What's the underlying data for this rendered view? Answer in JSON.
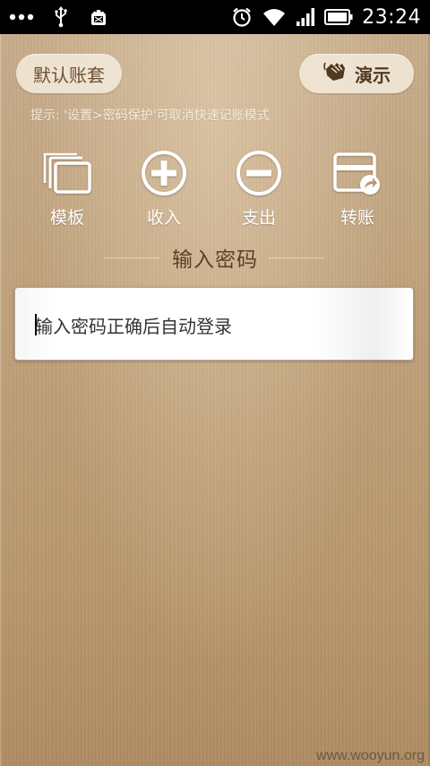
{
  "status_bar": {
    "time": "23:24",
    "left_icons": [
      "more-dots-icon",
      "usb-icon",
      "android-debug-icon"
    ],
    "right_icons": [
      "alarm-icon",
      "wifi-icon",
      "signal-icon",
      "battery-icon"
    ]
  },
  "top_bar": {
    "account_set_label": "默认账套",
    "demo_label": "演示"
  },
  "hint": "提示: '设置>密码保护'可取消快速记账模式",
  "actions": [
    {
      "label": "模板",
      "icon": "template-icon"
    },
    {
      "label": "收入",
      "icon": "income-plus-icon"
    },
    {
      "label": "支出",
      "icon": "expense-minus-icon"
    },
    {
      "label": "转账",
      "icon": "transfer-card-icon"
    }
  ],
  "password_section": {
    "title": "输入密码",
    "placeholder": "输入密码正确后自动登录"
  },
  "watermark": "www.wooyun.org",
  "colors": {
    "paper": "#c0a17a",
    "pill_bg": "#f5ebdc",
    "title_text": "#5c4128",
    "icon_white": "#ffffff"
  }
}
